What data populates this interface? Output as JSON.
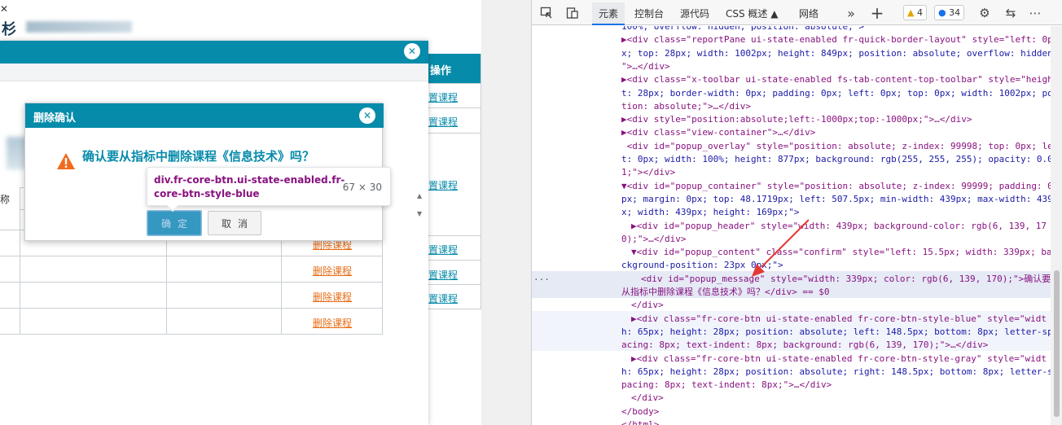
{
  "app": {
    "close_glyph": "✕",
    "page_title_glyph": "杉",
    "table": {
      "header_action": "操作",
      "right_links": [
        "置课程",
        "置课程",
        "置课程",
        "置课程",
        "置课程",
        "置课程"
      ],
      "delete_links": [
        "删除课程",
        "删除课程",
        "删除课程",
        "删除课程"
      ],
      "name_label": "称"
    }
  },
  "confirm_dialog": {
    "title": "删除确认",
    "message": "确认要从指标中删除课程《信息技术》吗？",
    "ok_label": "确定",
    "cancel_label": "取消",
    "warning_icon": "warning-triangle-icon",
    "accent_color": "#068baa"
  },
  "tooltip": {
    "selector": "div.fr-core-btn.ui-state-enabled.fr-core-btn-style-blue",
    "dimensions": "67 × 30"
  },
  "devtools": {
    "tabs": [
      "元素",
      "控制台",
      "源代码",
      "CSS 概述",
      "网络"
    ],
    "active_tab": "元素",
    "warnings_count": "4",
    "issues_count": "34",
    "lines": [
      {
        "indent": 0,
        "text": "100%; overflow: hidden; position: absolute;\">"
      },
      {
        "indent": 1,
        "text": "▶<div class=\"reportPane ui-state-enabled fr-quick-border-layout\" style=\"left: 0p"
      },
      {
        "indent": 0,
        "text": "x; top: 28px; width: 1002px; height: 849px; position: absolute; overflow: hidden;"
      },
      {
        "indent": 0,
        "text": "\">…</div>"
      },
      {
        "indent": 1,
        "text": "▶<div class=\"x-toolbar ui-state-enabled fs-tab-content-top-toolbar\" style=\"heigh"
      },
      {
        "indent": 0,
        "text": "t: 28px; border-width: 0px; padding: 0px; left: 0px; top: 0px; width: 1002px; posi"
      },
      {
        "indent": 0,
        "text": "tion: absolute;\">…</div>"
      },
      {
        "indent": 1,
        "text": "▶<div style=\"position:absolute;left:-1000px;top:-1000px;\">…</div>"
      },
      {
        "indent": 1,
        "text": "▶<div class=\"view-container\">…</div>"
      },
      {
        "indent": 1,
        "text": " <div id=\"popup_overlay\" style=\"position: absolute; z-index: 99998; top: 0px; lef"
      },
      {
        "indent": 0,
        "text": "t: 0px; width: 100%; height: 877px; background: rgb(255, 255, 255); opacity: 0.0"
      },
      {
        "indent": 0,
        "text": "1;\"></div>"
      },
      {
        "indent": 1,
        "text": "▼<div id=\"popup_container\" style=\"position: absolute; z-index: 99999; padding: 0"
      },
      {
        "indent": 0,
        "text": "px; margin: 0px; top: 48.1719px; left: 507.5px; min-width: 439px; max-width: 439p"
      },
      {
        "indent": 0,
        "text": "x; width: 439px; height: 169px;\">"
      },
      {
        "indent": 2,
        "text": "▶<div id=\"popup_header\" style=\"width: 439px; background-color: rgb(6, 139, 17"
      },
      {
        "indent": 0,
        "text": "0);\">…</div>"
      },
      {
        "indent": 2,
        "text": "▼<div id=\"popup_content\" class=\"confirm\" style=\"left: 15.5px; width: 339px; ba"
      },
      {
        "indent": 0,
        "text": "ckground-position: 23px 0px;\">"
      },
      {
        "indent": 3,
        "text": "<div id=\"popup_message\" style=\"width: 339px; color: rgb(6, 139, 170);\">确认要"
      },
      {
        "indent": 0,
        "text": "从指标中删除课程《信息技术》吗？</div> == $0"
      },
      {
        "indent": 2,
        "text": "</div>"
      },
      {
        "indent": 2,
        "text": "▶<div class=\"fr-core-btn ui-state-enabled fr-core-btn-style-blue\" style=\"widt"
      },
      {
        "indent": 0,
        "text": "h: 65px; height: 28px; position: absolute; left: 148.5px; bottom: 8px; letter-sp"
      },
      {
        "indent": 0,
        "text": "acing: 8px; text-indent: 8px; background: rgb(6, 139, 170);\">…</div>"
      },
      {
        "indent": 2,
        "text": "▶<div class=\"fr-core-btn ui-state-enabled fr-core-btn-style-gray\" style=\"widt"
      },
      {
        "indent": 0,
        "text": "h: 65px; height: 28px; position: absolute; right: 148.5px; bottom: 8px; letter-s"
      },
      {
        "indent": 0,
        "text": "pacing: 8px; text-indent: 8px;\">…</div>"
      },
      {
        "indent": 2,
        "text": "</div>"
      },
      {
        "indent": 1,
        "text": "</body>"
      },
      {
        "indent": 0,
        "text": "</html>"
      }
    ],
    "ellipsis_marker": "···"
  }
}
